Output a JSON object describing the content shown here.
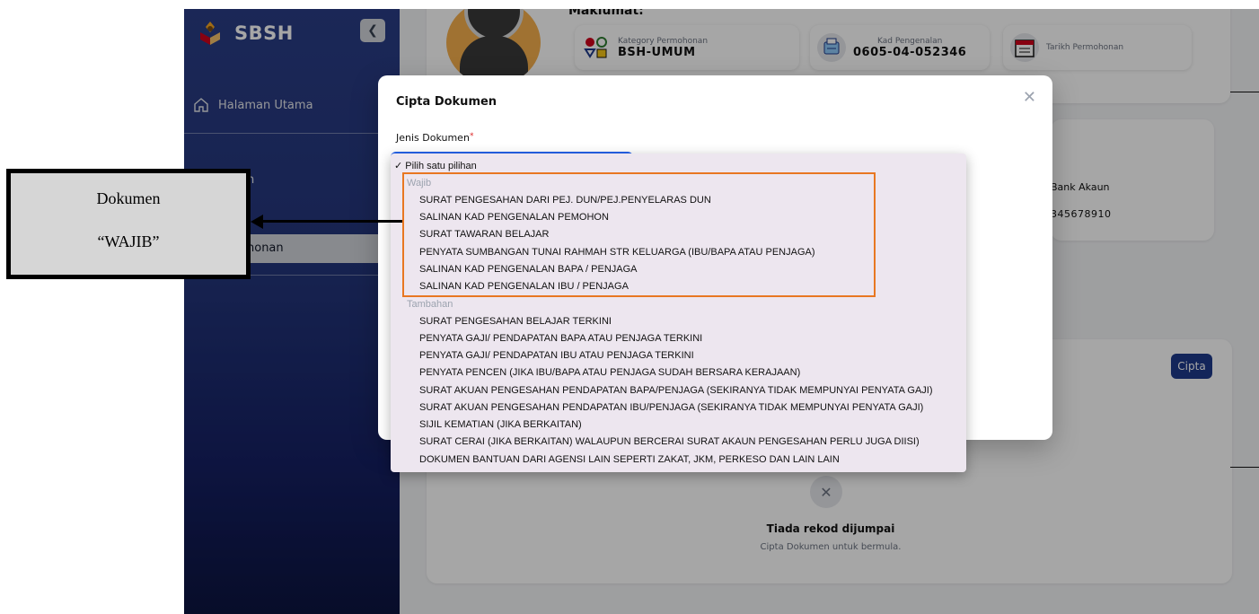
{
  "sidebar": {
    "app_name": "SBSH",
    "home_label": "Halaman Utama",
    "item_2_label": "n",
    "active_item_label": "honan"
  },
  "profile": {
    "section_title": "Maklumat:",
    "kategori_label": "Kategory Permohonan",
    "kategori_value": "BSH-UMUM",
    "kad_label": "Kad Pengenalan",
    "kad_value": "0605-04-052346",
    "tarikh_label": "Tarikh Permohonan"
  },
  "bank": {
    "label": "Bank Akaun",
    "value": "345678910"
  },
  "documents": {
    "create_button": "Cipta",
    "empty_title": "Tiada rekod dijumpai",
    "empty_subtitle": "Cipta Dokumen untuk bermula."
  },
  "modal": {
    "title": "Cipta Dokumen",
    "field_label": "Jenis Dokumen",
    "required_mark": "*",
    "close_icon": "close-icon"
  },
  "dropdown": {
    "selected": "✓ Pilih satu pilihan",
    "groups": [
      {
        "label": "Wajib",
        "options": [
          "SURAT PENGESAHAN DARI PEJ. DUN/PEJ.PENYELARAS DUN",
          "SALINAN KAD PENGENALAN PEMOHON",
          "SURAT TAWARAN BELAJAR",
          "PENYATA SUMBANGAN TUNAI RAHMAH STR KELUARGA (IBU/BAPA ATAU PENJAGA)",
          "SALINAN KAD PENGENALAN BAPA / PENJAGA",
          "SALINAN KAD PENGENALAN IBU / PENJAGA"
        ]
      },
      {
        "label": "Tambahan",
        "options": [
          "SURAT PENGESAHAN BELAJAR TERKINI",
          "PENYATA GAJI/ PENDAPATAN BAPA ATAU PENJAGA TERKINI",
          "PENYATA GAJI/ PENDAPATAN IBU ATAU PENJAGA TERKINI",
          "PENYATA PENCEN (JIKA IBU/BAPA ATAU PENJAGA SUDAH BERSARA KERAJAAN)",
          "SURAT AKUAN PENGESAHAN PENDAPATAN BAPA/PENJAGA (SEKIRANYA TIDAK MEMPUNYAI PENYATA GAJI)",
          "SURAT AKUAN PENGESAHAN PENDAPATAN IBU/PENJAGA (SEKIRANYA TIDAK MEMPUNYAI PENYATA GAJI)",
          "SIJIL KEMATIAN (JIKA BERKAITAN)",
          "SURAT CERAI (JIKA BERKAITAN) WALAUPUN BERCERAI SURAT AKAUN PENGESAHAN PERLU JUGA DIISI)",
          "DOKUMEN BANTUAN DARI AGENSI LAIN SEPERTI ZAKAT, JKM, PERKESO DAN LAIN LAIN"
        ]
      }
    ]
  },
  "annotation": {
    "line_1": "Dokumen",
    "line_2": "“WAJIB”",
    "highlight_color": "#e87722"
  }
}
